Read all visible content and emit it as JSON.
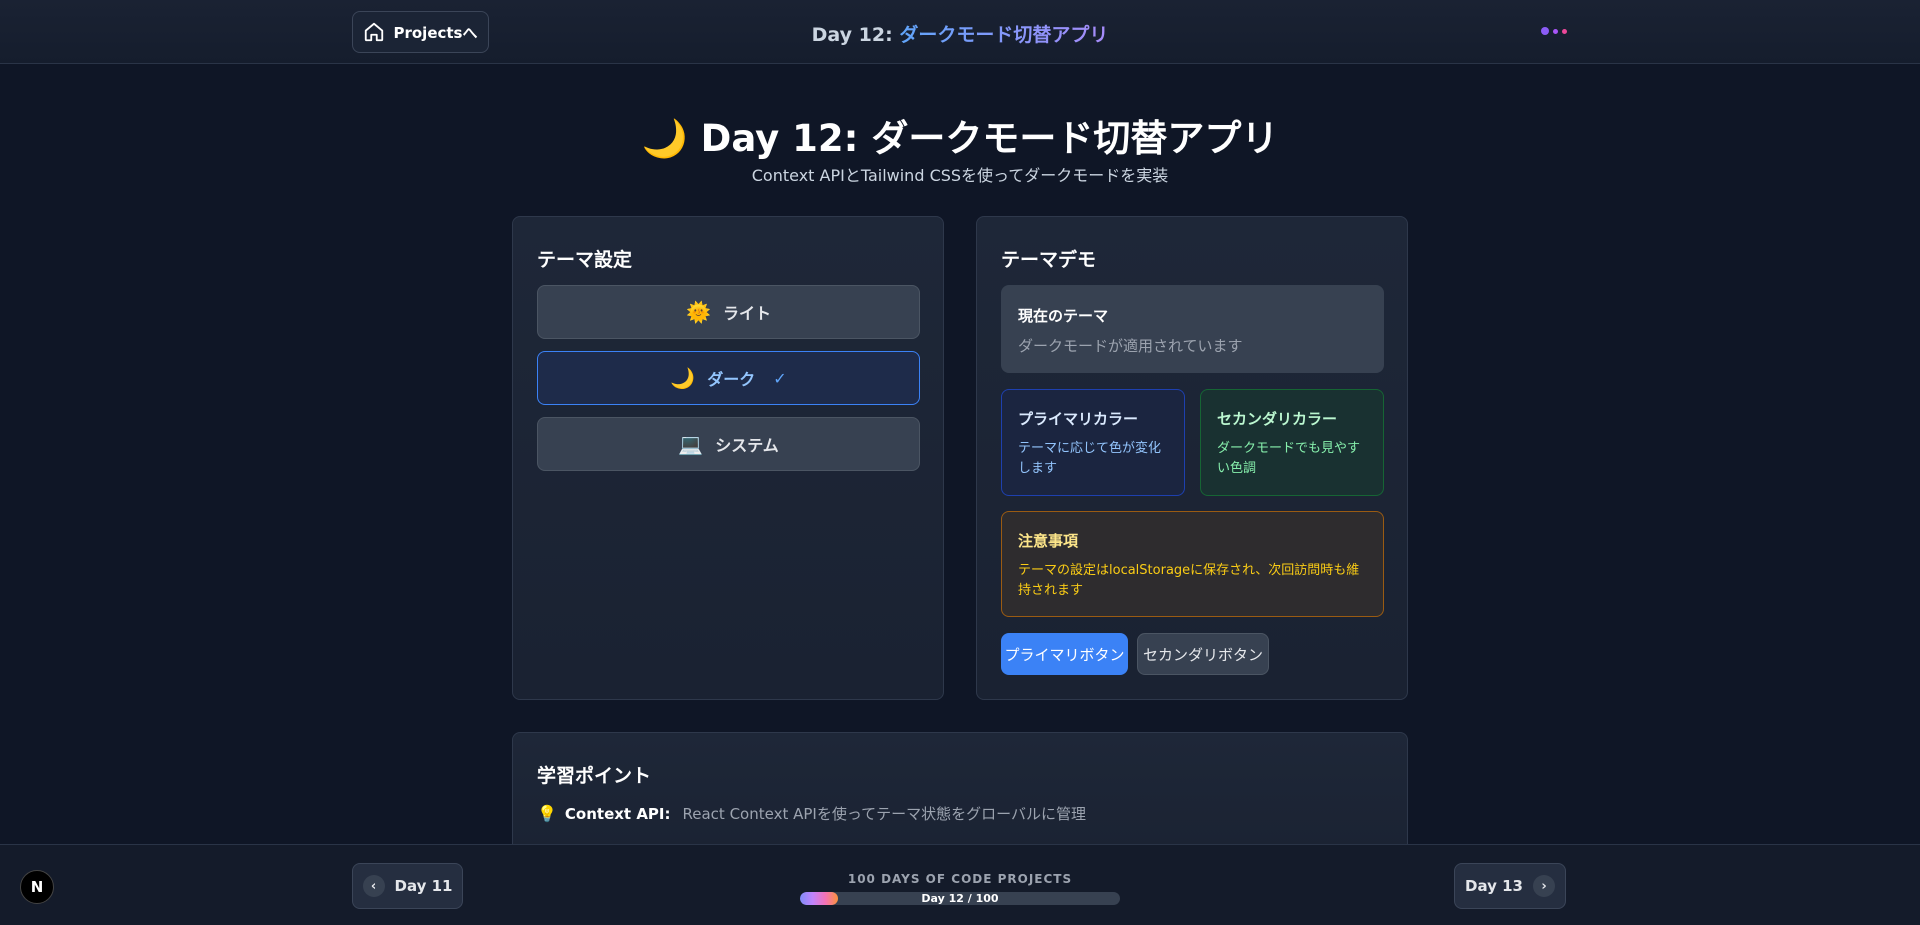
{
  "header": {
    "home_label": "Projectsへ",
    "title_prefix": "Day 12: ",
    "title_accent": "ダークモード切替アプリ"
  },
  "hero": {
    "emoji": "🌙",
    "title": "Day 12: ダークモード切替アプリ",
    "subtitle": "Context APIとTailwind CSSを使ってダークモードを実装"
  },
  "theme_settings": {
    "title": "テーマ設定",
    "options": [
      {
        "emoji": "🌞",
        "label": "ライト",
        "active": false
      },
      {
        "emoji": "🌙",
        "label": "ダーク",
        "active": true,
        "check": "✓"
      },
      {
        "emoji": "💻",
        "label": "システム",
        "active": false
      }
    ]
  },
  "theme_demo": {
    "title": "テーマデモ",
    "current": {
      "title": "現在のテーマ",
      "desc": "ダークモードが適用されています"
    },
    "primary": {
      "title": "プライマリカラー",
      "desc": "テーマに応じて色が変化します"
    },
    "secondary": {
      "title": "セカンダリカラー",
      "desc": "ダークモードでも見やすい色調"
    },
    "notice": {
      "title": "注意事項",
      "desc": "テーマの設定はlocalStorageに保存され、次回訪問時も維持されます"
    },
    "primary_button": "プライマリボタン",
    "secondary_button": "セカンダリボタン"
  },
  "learning": {
    "title": "学習ポイント",
    "items": [
      {
        "icon": "lightbulb-icon",
        "key": "Context API:",
        "value": "React Context APIを使ってテーマ状態をグローバルに管理"
      }
    ]
  },
  "footer": {
    "prev_label": "Day 11",
    "next_label": "Day 13",
    "progress_label": "100 DAYS OF CODE PROJECTS",
    "progress_text": "Day 12 / 100",
    "progress_value": 0.12,
    "logo_letter": "N"
  },
  "colors": {
    "accent": "#3b82f6",
    "background": "#0f1626",
    "card": "#1e2738"
  }
}
